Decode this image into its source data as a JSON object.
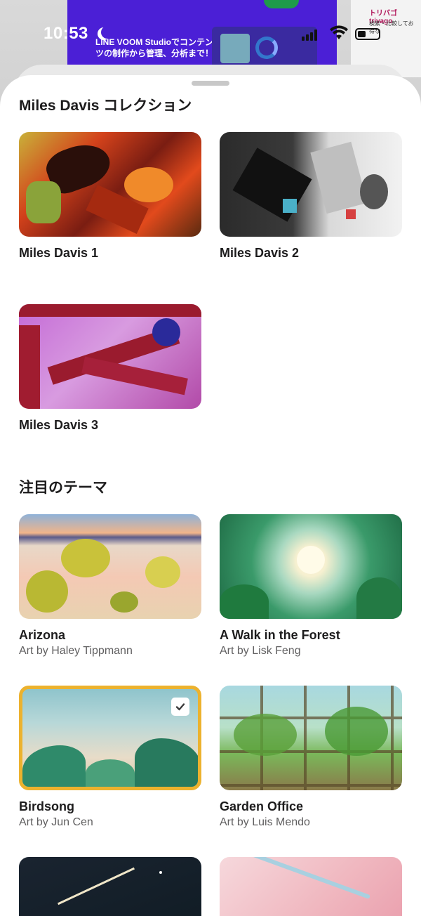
{
  "status_bar": {
    "time": "10:53"
  },
  "background_app": {
    "banner_text": "LINE VOOM Studioでコンテンツの制作から管理、分析まで！",
    "card_title": "トリバゴ trivago",
    "card_text": "検索・比較してお得な"
  },
  "sections": [
    {
      "title": "Miles Davis コレクション",
      "items": [
        {
          "title": "Miles Davis 1"
        },
        {
          "title": "Miles Davis 2"
        },
        {
          "title": "Miles Davis 3"
        }
      ]
    },
    {
      "title": "注目のテーマ",
      "items": [
        {
          "title": "Arizona",
          "subtitle": "Art by Haley Tippmann"
        },
        {
          "title": "A Walk in the Forest",
          "subtitle": "Art by Lisk Feng"
        },
        {
          "title": "Birdsong",
          "subtitle": "Art by Jun Cen",
          "selected": true
        },
        {
          "title": "Garden Office",
          "subtitle": "Art by Luis Mendo"
        }
      ]
    }
  ],
  "colors": {
    "selected_border": "#ecb22e",
    "title_text": "#1d1c1d",
    "subtitle_text": "#616061"
  }
}
